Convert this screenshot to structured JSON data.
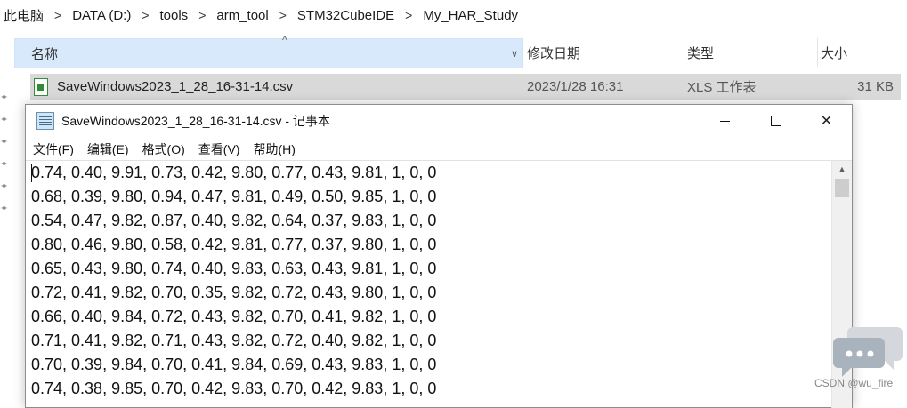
{
  "breadcrumb": [
    "此电脑",
    "DATA (D:)",
    "tools",
    "arm_tool",
    "STM32CubeIDE",
    "My_HAR_Study"
  ],
  "columns": {
    "name": "名称",
    "date": "修改日期",
    "type": "类型",
    "size": "大小"
  },
  "file": {
    "name": "SaveWindows2023_1_28_16-31-14.csv",
    "date": "2023/1/28 16:31",
    "type": "XLS 工作表",
    "size": "31 KB"
  },
  "notepad": {
    "title": "SaveWindows2023_1_28_16-31-14.csv - 记事本",
    "menu": [
      "文件(F)",
      "编辑(E)",
      "格式(O)",
      "查看(V)",
      "帮助(H)"
    ],
    "lines": [
      "0.74, 0.40, 9.91, 0.73, 0.42, 9.80, 0.77, 0.43, 9.81, 1, 0, 0",
      "0.68, 0.39, 9.80, 0.94, 0.47, 9.81, 0.49, 0.50, 9.85, 1, 0, 0",
      "0.54, 0.47, 9.82, 0.87, 0.40, 9.82, 0.64, 0.37, 9.83, 1, 0, 0",
      "0.80, 0.46, 9.80, 0.58, 0.42, 9.81, 0.77, 0.37, 9.80, 1, 0, 0",
      "0.65, 0.43, 9.80, 0.74, 0.40, 9.83, 0.63, 0.43, 9.81, 1, 0, 0",
      "0.72, 0.41, 9.82, 0.70, 0.35, 9.82, 0.72, 0.43, 9.80, 1, 0, 0",
      "0.66, 0.40, 9.84, 0.72, 0.43, 9.82, 0.70, 0.41, 9.82, 1, 0, 0",
      "0.71, 0.41, 9.82, 0.71, 0.43, 9.82, 0.72, 0.40, 9.82, 1, 0, 0",
      "0.70, 0.39, 9.84, 0.70, 0.41, 9.84, 0.69, 0.43, 9.83, 1, 0, 0",
      "0.74, 0.38, 9.85, 0.70, 0.42, 9.83, 0.70, 0.42, 9.83, 1, 0, 0"
    ]
  },
  "watermark": "CSDN @wu_fire"
}
